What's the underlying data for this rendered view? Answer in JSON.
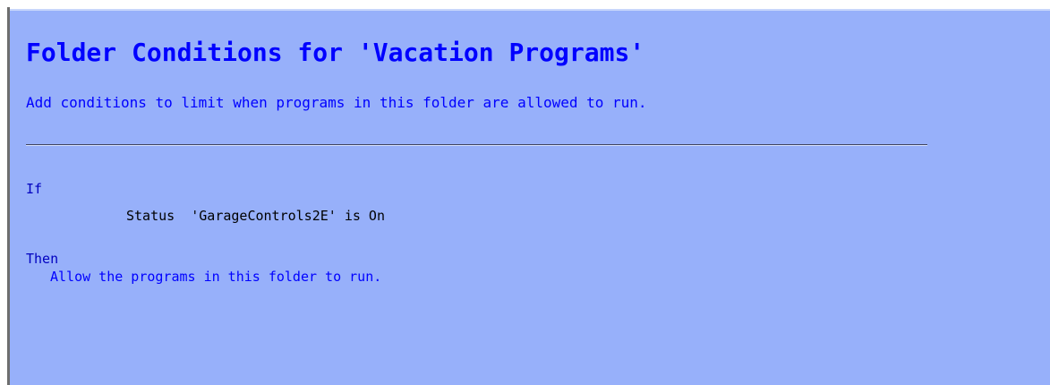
{
  "header": {
    "title": "Folder Conditions for 'Vacation Programs'",
    "subtitle": "Add conditions to limit when programs in this folder are allowed to run."
  },
  "program": {
    "if_keyword": "If",
    "condition": "Status  'GarageControls2E' is On",
    "then_keyword": "Then",
    "action": "Allow the programs in this folder to run."
  },
  "colors": {
    "panel_background": "#97b0fa",
    "heading_text": "#0000ff",
    "condition_text": "#000000"
  }
}
